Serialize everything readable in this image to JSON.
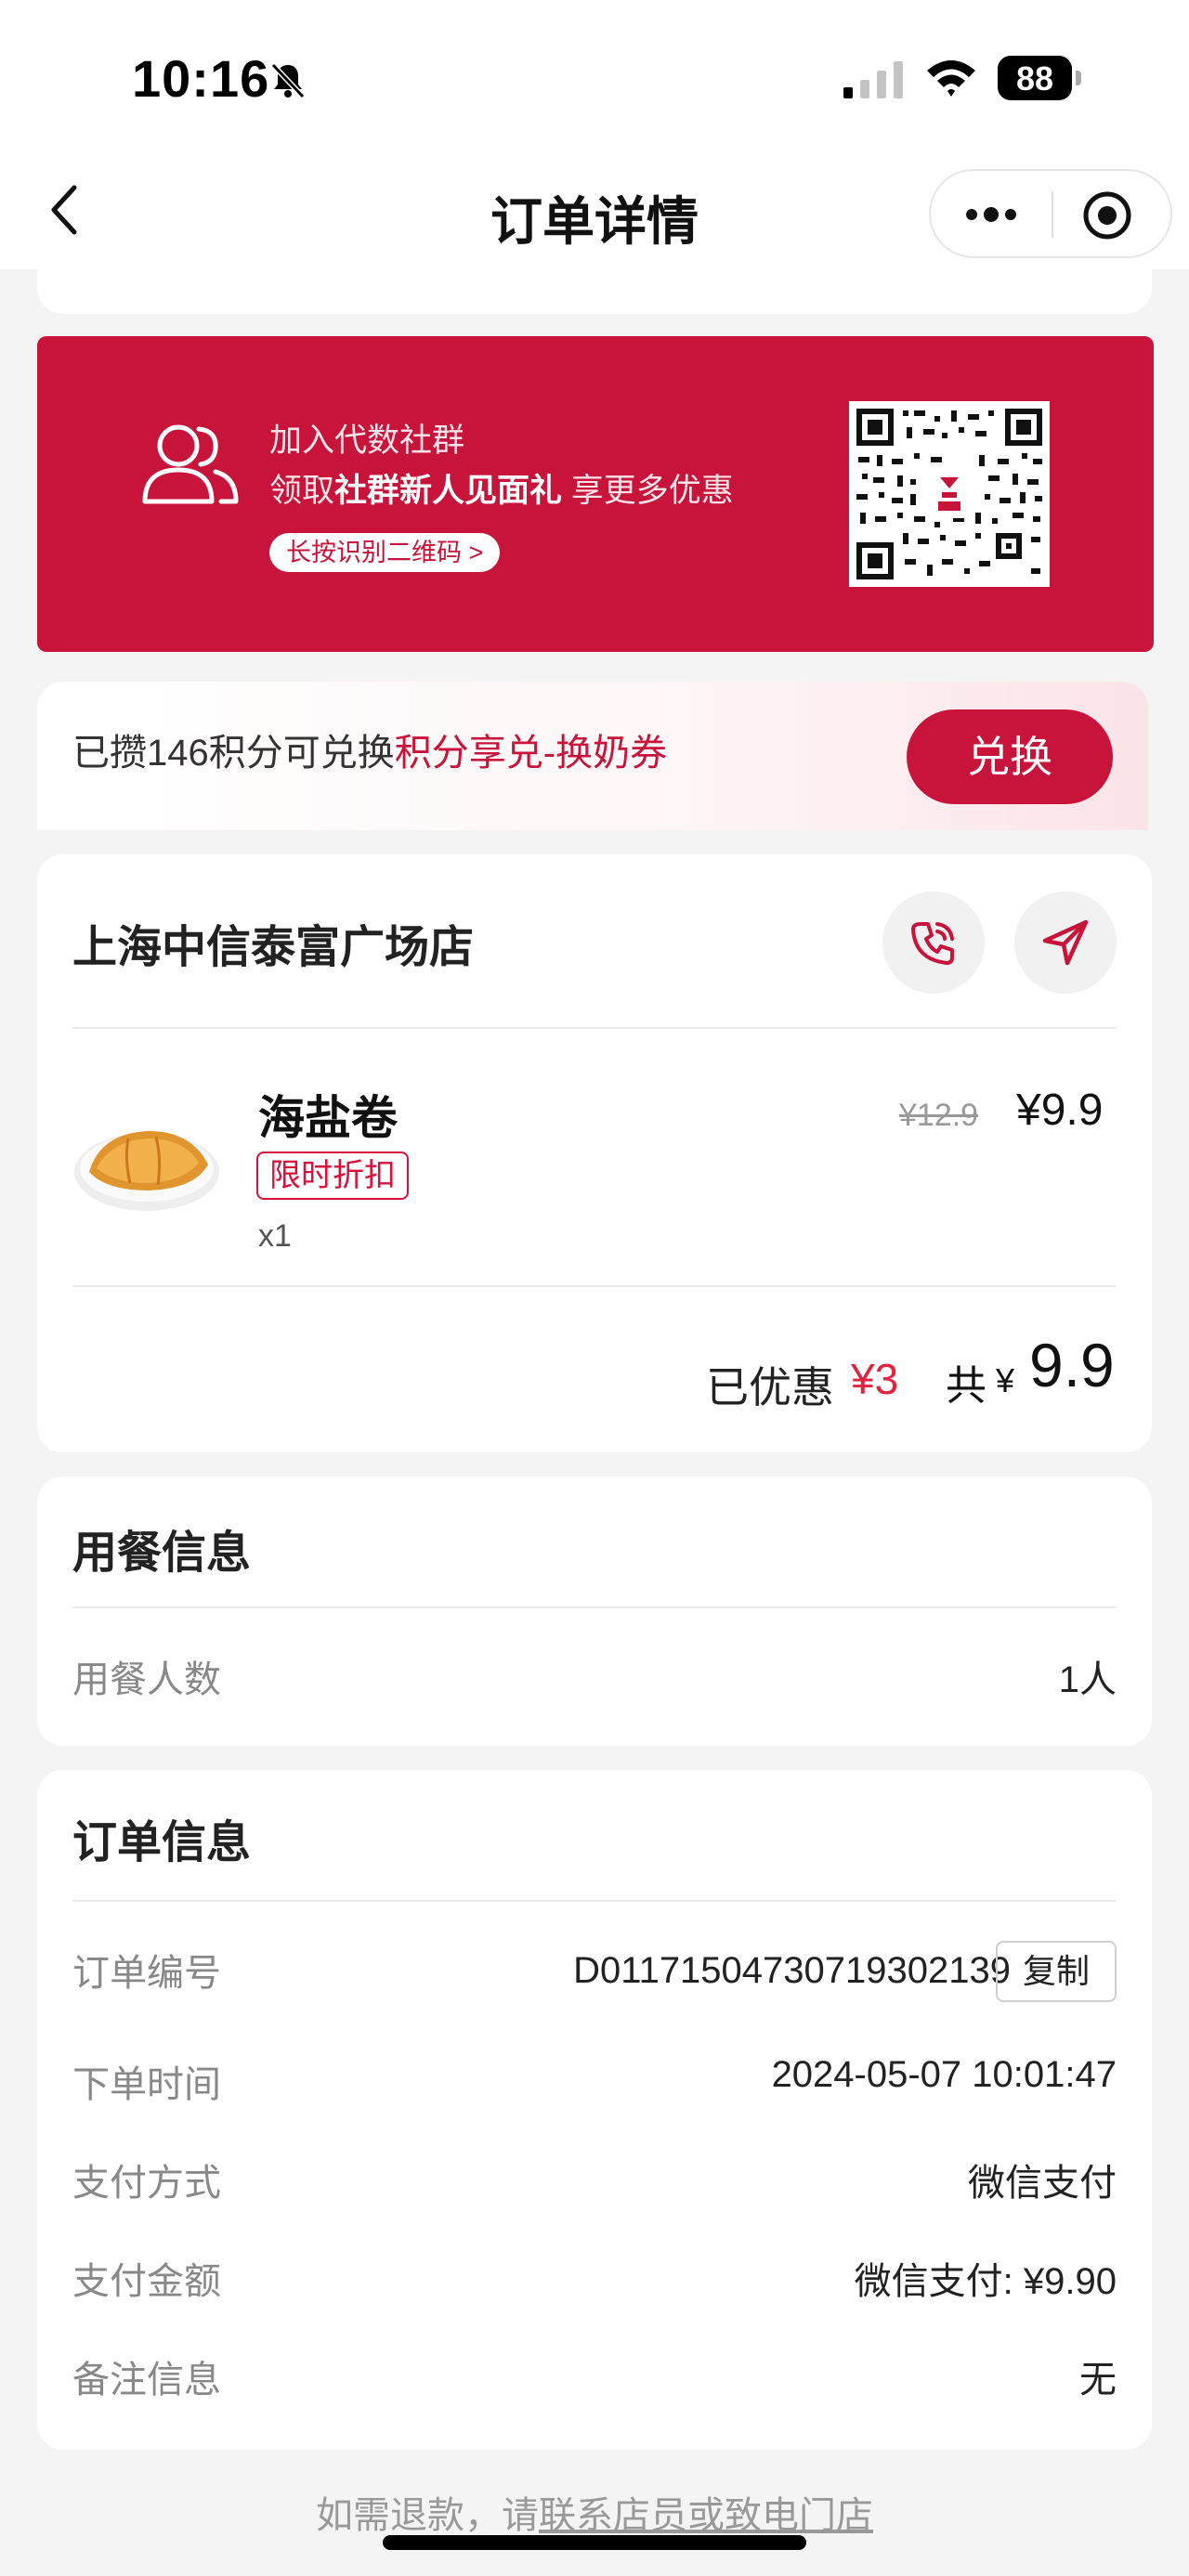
{
  "status_bar": {
    "time": "10:16",
    "battery_level": "88",
    "icons": [
      "bell-slash-icon",
      "signal-icon",
      "wifi-icon",
      "battery-icon"
    ]
  },
  "nav": {
    "title": "订单详情",
    "icons": [
      "back-icon",
      "more-icon",
      "target-icon"
    ]
  },
  "community_banner": {
    "line1": "加入代数社群",
    "line2_prefix": "领取",
    "line2_bold": "社群新人见面礼",
    "line2_suffix": "享更多优惠",
    "qr_hint": "长按识别二维码 >",
    "icon": "users-icon",
    "accent_color": "#c8133a"
  },
  "points": {
    "prefix": "已攒146积分可兑换",
    "highlight": "积分享兑-换奶券",
    "button_label": "兑换"
  },
  "store": {
    "name": "上海中信泰富广场店",
    "icons": [
      "phone-icon",
      "navigation-icon"
    ],
    "product": {
      "name": "海盐卷",
      "tag": "限时折扣",
      "quantity": "x1",
      "original_price": "¥12.9",
      "price": "¥9.9"
    },
    "saved_label": "已优惠",
    "saved_amount": "¥3",
    "total_label": "共",
    "total_currency": "¥",
    "total_amount": "9.9"
  },
  "dining": {
    "title": "用餐信息",
    "rows": [
      {
        "label": "用餐人数",
        "value": "1人"
      }
    ]
  },
  "order": {
    "title": "订单信息",
    "number_label": "订单编号",
    "number_value": "D01171504730719302139",
    "copy_label": "复制",
    "rows": [
      {
        "label": "下单时间",
        "value": "2024-05-07 10:01:47"
      },
      {
        "label": "支付方式",
        "value": "微信支付"
      },
      {
        "label": "支付金额",
        "value": "微信支付: ¥9.90"
      },
      {
        "label": "备注信息",
        "value": "无"
      }
    ]
  },
  "footer": {
    "refund_prefix": "如需退款，请",
    "refund_link": "联系店员或致电门店"
  }
}
